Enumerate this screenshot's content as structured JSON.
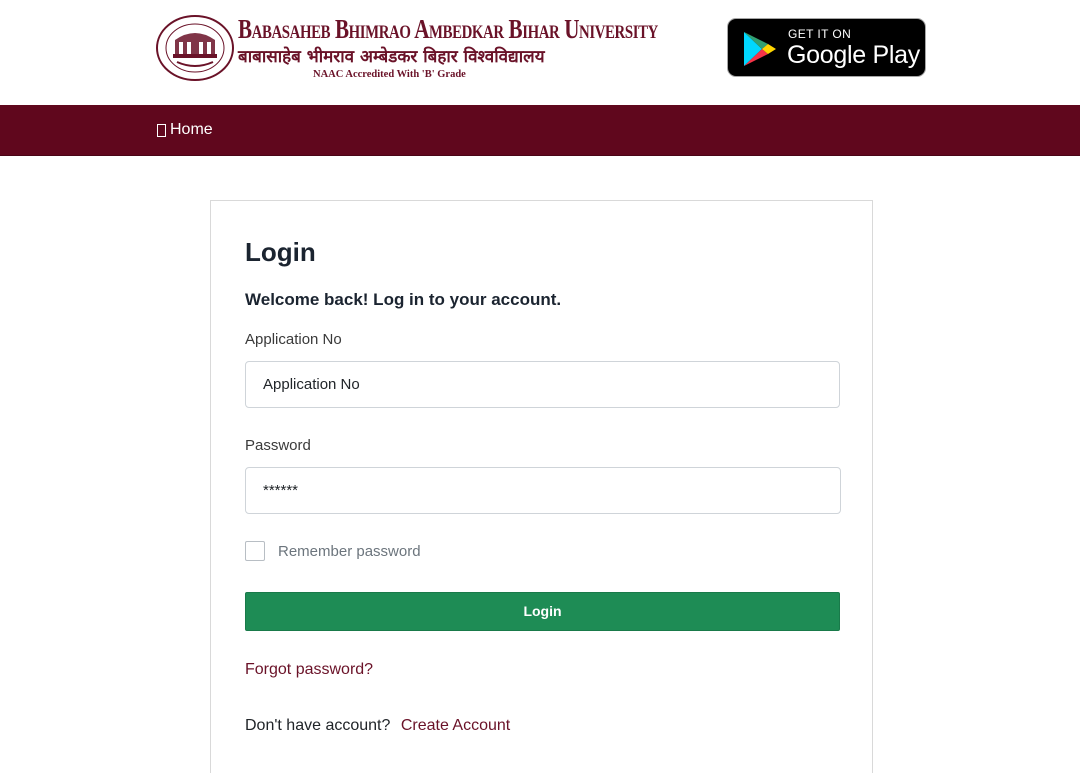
{
  "header": {
    "university_name_en": "Babasaheb Bhimrao Ambedkar Bihar University",
    "university_name_hi": "बाबासाहेब भीमराव अम्बेडकर बिहार विश्वविद्यालय",
    "accreditation": "NAAC Accredited With 'B' Grade",
    "store_badge": {
      "small_text": "GET IT ON",
      "big_text": "Google Play"
    }
  },
  "nav": {
    "home_label": "Home"
  },
  "login": {
    "title": "Login",
    "subtitle": "Welcome back! Log in to your account.",
    "application_label": "Application No",
    "application_placeholder": "Application No",
    "password_label": "Password",
    "password_placeholder": "******",
    "remember_label": "Remember password",
    "remember_checked": false,
    "submit_label": "Login",
    "forgot_label": "Forgot password?",
    "no_account_text": "Don't have account?",
    "create_account_label": "Create Account"
  },
  "colors": {
    "brand_maroon": "#60071d",
    "accent_green": "#1e8c55",
    "link_color": "#6a1228"
  }
}
